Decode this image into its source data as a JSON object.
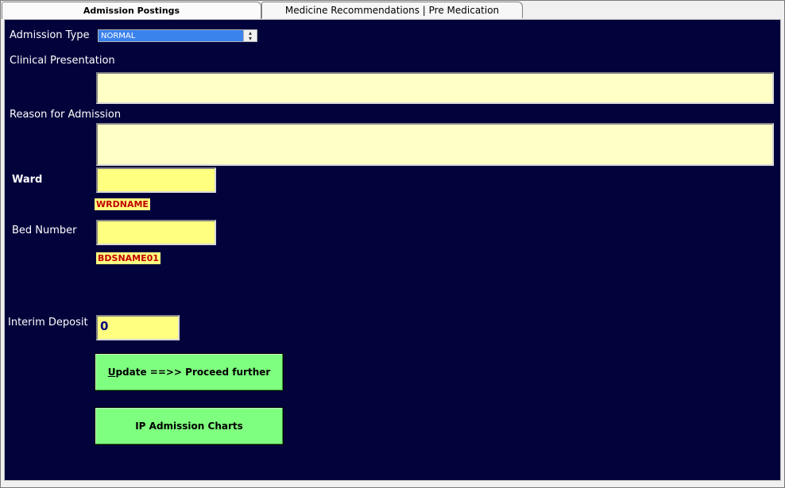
{
  "tabs": [
    {
      "label": "Admission Postings",
      "active": true
    },
    {
      "label": "Medicine Recommendations | Pre Medication",
      "active": false
    }
  ],
  "form": {
    "admission_type_label": "Admission Type",
    "admission_type_value": "NORMAL",
    "clinical_presentation_label": "Clinical Presentation",
    "clinical_presentation_value": "",
    "reason_label": "Reason for Admission",
    "reason_value": "",
    "ward_label": "Ward",
    "ward_value": "",
    "ward_name": "WRDNAME",
    "bed_label": "Bed Number",
    "bed_value": "",
    "bed_name": "BDSNAME01",
    "deposit_label": "Interim Deposit",
    "deposit_value": "0"
  },
  "buttons": {
    "update_hotkey": "U",
    "update_rest": "pdate ==>> Proceed further",
    "charts_label": "IP Admission Charts"
  },
  "colors": {
    "panel_bg": "#03033c",
    "textarea_bg": "#ffffc6",
    "input_bg": "#ffff80",
    "tag_text": "#c00000",
    "button_bg": "#7fff80",
    "select_bg": "#3a82ec"
  }
}
